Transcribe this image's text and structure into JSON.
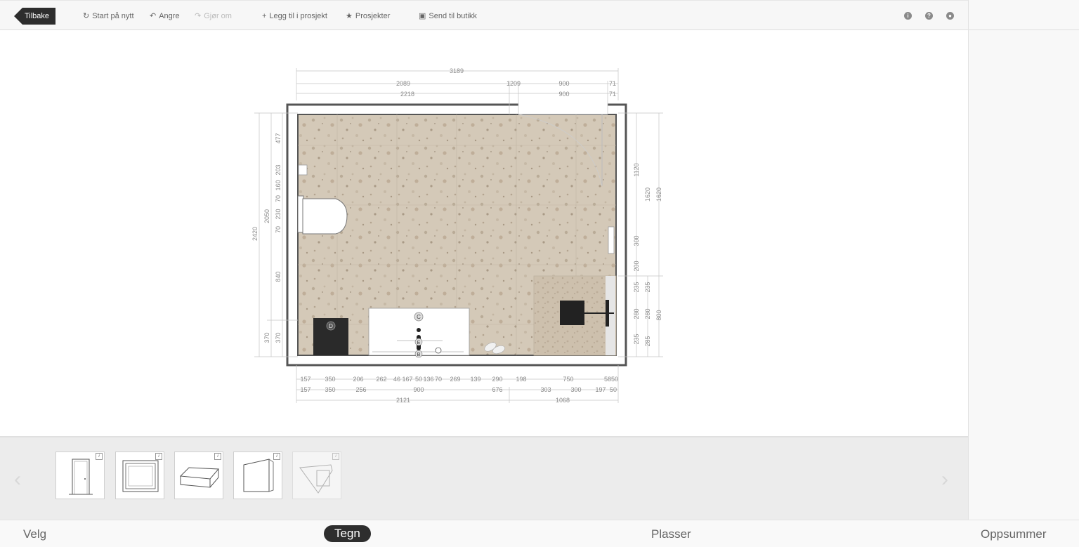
{
  "toolbar": {
    "back_label": "Tilbake",
    "start_over": "Start på nytt",
    "undo": "Angre",
    "redo": "Gjør om",
    "add_to_project": "Legg til i prosjekt",
    "projects": "Prosjekter",
    "send_to_store": "Send til butikk",
    "icons": [
      "info-icon",
      "help-icon",
      "user-icon"
    ]
  },
  "plan": {
    "top_dims": {
      "row1": [
        "3189"
      ],
      "row2": [
        "2089",
        "1209",
        "900",
        "71"
      ],
      "row3": [
        "2218",
        "900",
        "71"
      ]
    },
    "left_dims": {
      "outer": "2420",
      "mid": [
        "2050",
        "370"
      ],
      "inner": [
        "477",
        "203",
        "160",
        "70",
        "230",
        "70",
        "840",
        "370"
      ]
    },
    "right_dims": {
      "inner": [
        "1120",
        "300",
        "200",
        "235",
        "280",
        "235"
      ],
      "inner2": [
        "235",
        "280",
        "285"
      ],
      "mid": [
        "1620"
      ],
      "outer": [
        "1620",
        "800"
      ]
    },
    "bottom_dims": {
      "row1": [
        "157",
        "350",
        "206",
        "262",
        "46",
        "167",
        "50",
        "136",
        "70",
        "269",
        "139",
        "290",
        "198",
        "750",
        "58",
        "50"
      ],
      "row2": [
        "157",
        "350",
        "256",
        "900",
        "676",
        "303",
        "300",
        "197",
        "50"
      ],
      "row3": [
        "2121",
        "1068"
      ]
    },
    "labels": [
      "C",
      "D",
      "E",
      "B"
    ]
  },
  "tray": {
    "items": [
      {
        "name": "door",
        "info": "i"
      },
      {
        "name": "window",
        "info": "i"
      },
      {
        "name": "box",
        "info": "i"
      },
      {
        "name": "wall-niche",
        "info": "i"
      },
      {
        "name": "skylight",
        "info": "i"
      }
    ]
  },
  "steps": {
    "velg": "Velg",
    "tegn": "Tegn",
    "plasser": "Plasser",
    "oppsummer": "Oppsummer"
  },
  "colors": {
    "floor": "#d3c7b6",
    "accent": "#2e2e2e"
  }
}
